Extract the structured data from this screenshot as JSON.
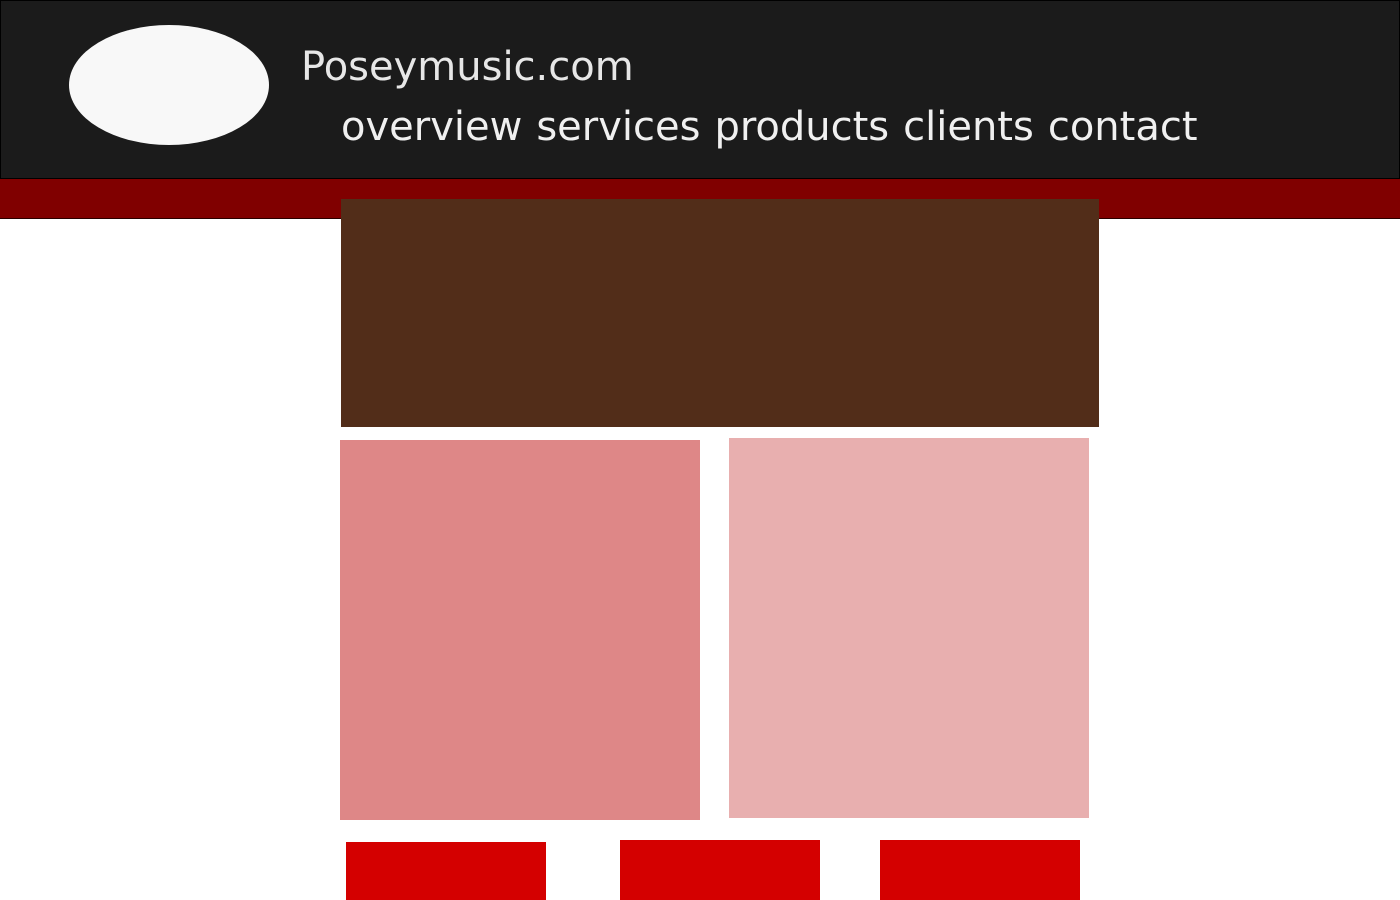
{
  "header": {
    "site_title": "Poseymusic.com",
    "logo": "oval-logo",
    "nav": {
      "items": [
        {
          "label": "overview"
        },
        {
          "label": "services"
        },
        {
          "label": "products"
        },
        {
          "label": "clients"
        },
        {
          "label": "contact"
        }
      ]
    }
  },
  "colors": {
    "header_bg": "#1b1b1b",
    "accent_bar": "#800000",
    "hero": "#522d19",
    "panel_left": "#de8787",
    "panel_right": "#e8afaf",
    "button": "#d40000",
    "page_bg": "#ffffff"
  }
}
